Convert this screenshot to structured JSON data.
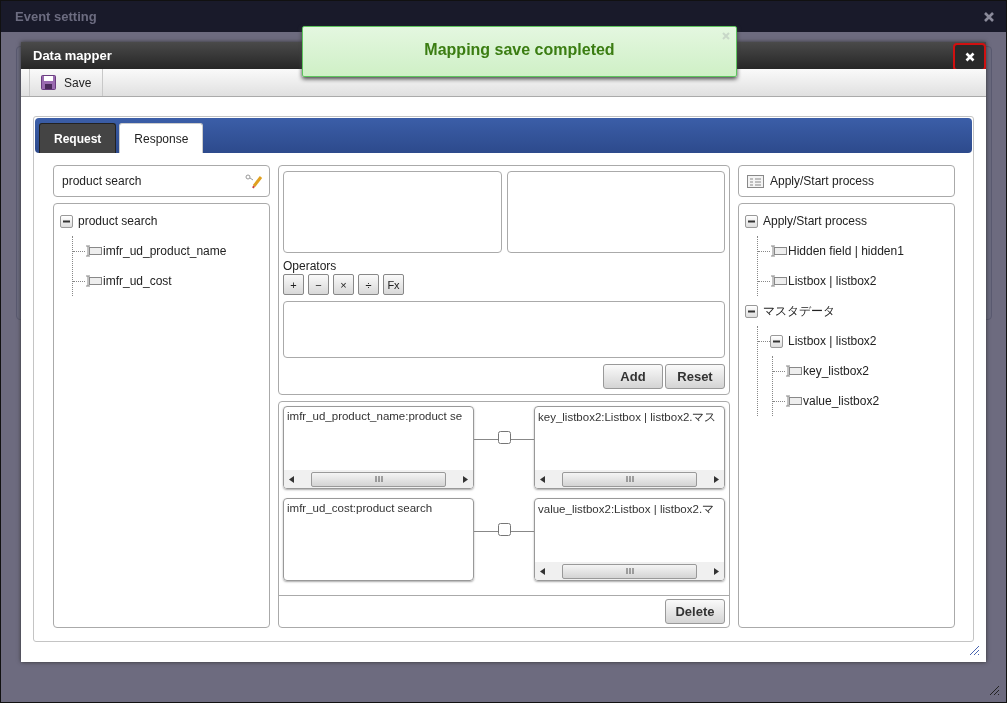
{
  "window": {
    "title": "Event setting"
  },
  "toast": {
    "message": "Mapping save completed"
  },
  "dialog": {
    "title": "Data mapper",
    "close_highlighted": true
  },
  "toolbar": {
    "buttons": [
      {
        "label": "Save"
      }
    ]
  },
  "tabs": [
    {
      "label": "Request",
      "selected": false
    },
    {
      "label": "Response",
      "selected": true
    }
  ],
  "source_panel": {
    "title": "product search",
    "tree": [
      {
        "label": "product search",
        "kind": "group",
        "expanded": true,
        "children": [
          {
            "label": "imfr_ud_product_name",
            "kind": "field"
          },
          {
            "label": "imfr_ud_cost",
            "kind": "field"
          }
        ]
      }
    ]
  },
  "expression_panel": {
    "operators_label": "Operators",
    "operators": [
      "+",
      "−",
      "×",
      "÷",
      "Fx"
    ],
    "buttons": [
      "Add",
      "Reset"
    ]
  },
  "mappings": [
    {
      "source": "imfr_ud_product_name:product se",
      "source_scrollable": true,
      "checked": false,
      "target": "key_listbox2:Listbox | listbox2.マス",
      "target_scrollable": true
    },
    {
      "source": "imfr_ud_cost:product search",
      "source_scrollable": false,
      "checked": false,
      "target": "value_listbox2:Listbox | listbox2.マ",
      "target_scrollable": true
    }
  ],
  "mapping_buttons": [
    "Delete"
  ],
  "target_panel": {
    "title": "Apply/Start process",
    "tree": [
      {
        "label": "Apply/Start process",
        "kind": "group",
        "expanded": true,
        "children": [
          {
            "label": "Hidden field | hidden1",
            "kind": "field"
          },
          {
            "label": "Listbox | listbox2",
            "kind": "field"
          }
        ]
      },
      {
        "label": "マスタデータ",
        "kind": "group",
        "expanded": true,
        "children": [
          {
            "label": "Listbox | listbox2",
            "kind": "group",
            "expanded": true,
            "children": [
              {
                "label": "key_listbox2",
                "kind": "field"
              },
              {
                "label": "value_listbox2",
                "kind": "field"
              }
            ]
          }
        ]
      }
    ]
  }
}
